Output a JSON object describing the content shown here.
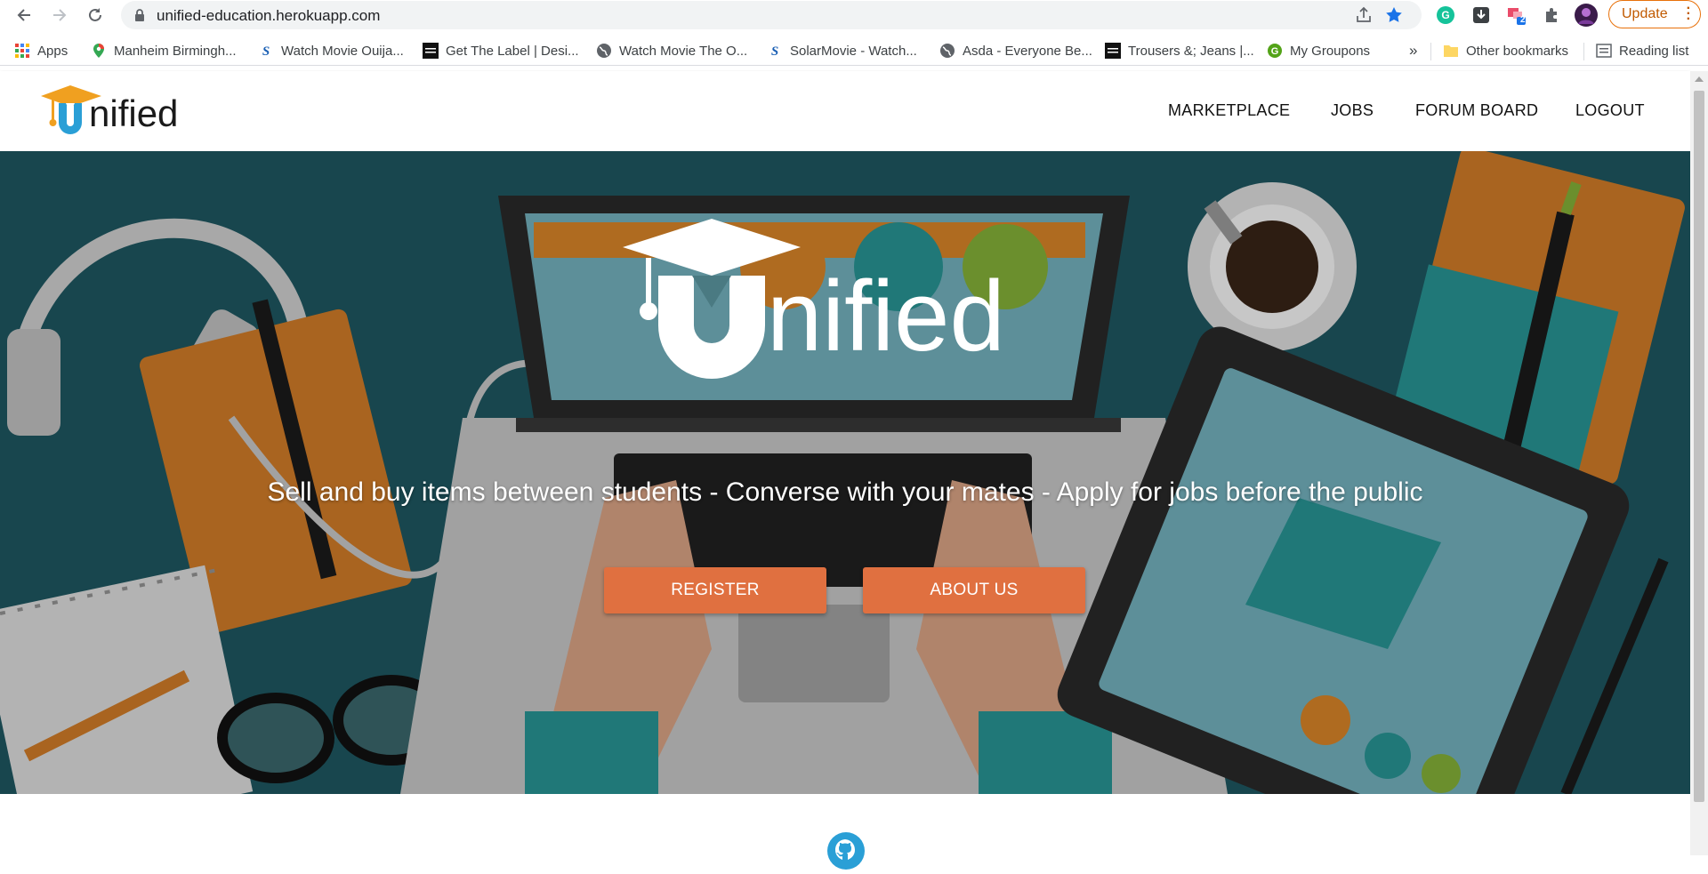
{
  "browser": {
    "url": "unified-education.herokuapp.com",
    "update_label": "Update",
    "extension_badge": "2"
  },
  "bookmarks": {
    "apps": "Apps",
    "items": [
      {
        "label": "Manheim Birmingh...",
        "icon": "maps-pin-icon"
      },
      {
        "label": "Watch Movie Ouija...",
        "icon": "solarmovie-icon"
      },
      {
        "label": "Get The Label | Desi...",
        "icon": "gtl-icon"
      },
      {
        "label": "Watch Movie The O...",
        "icon": "globe-icon"
      },
      {
        "label": "SolarMovie - Watch...",
        "icon": "solarmovie-icon"
      },
      {
        "label": "Asda - Everyone Be...",
        "icon": "globe-icon"
      },
      {
        "label": "Trousers &; Jeans |...",
        "icon": "gtl-icon"
      },
      {
        "label": "My Groupons",
        "icon": "groupon-icon"
      }
    ],
    "overflow": "»",
    "other": "Other bookmarks",
    "reading_list": "Reading list"
  },
  "site": {
    "logo_text": "nified",
    "nav": [
      "MARKETPLACE",
      "JOBS",
      "FORUM BOARD",
      "LOGOUT"
    ],
    "hero_logo_text": "nified",
    "tagline": "Sell and buy items between students - Converse with your mates - Apply for jobs before the public",
    "register_label": "REGISTER",
    "about_label": "ABOUT US"
  },
  "colors": {
    "accent": "#e07040",
    "hero_bg": "#1f5a64",
    "logo_blue": "#2a9fd6",
    "logo_cap": "#f0a020"
  }
}
